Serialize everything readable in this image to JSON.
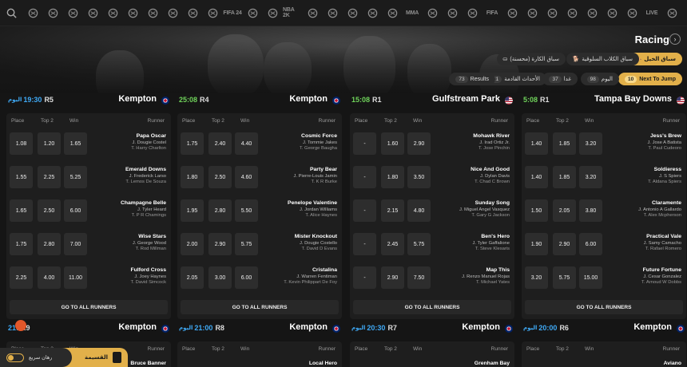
{
  "sports_bar": {
    "icons": [
      "search-icon",
      "american-football-icon",
      "boxing-icon",
      "cycling-icon",
      "golf-icon",
      "handball-icon",
      "flag-icon",
      "rugby-icon",
      "hockey-icon",
      "snooker-icon",
      "table-tennis-icon",
      "fifa-icon",
      "cricket-icon",
      "baseball-bat-icon",
      "nba-icon",
      "darts-icon",
      "tennis-icon",
      "volleyball-icon",
      "esports-icon",
      "billiards-icon",
      "mma-icon",
      "badminton-icon",
      "horse-icon",
      "shooting-icon",
      "fifa-icon-2",
      "motorsport-icon",
      "chat-icon",
      "basketball-icon",
      "tennis-racket-icon",
      "soccer-icon",
      "copy-icon",
      "tv-icon",
      "live-icon",
      "home-icon"
    ],
    "text_icons": {
      "fifa": "FIFA 24",
      "nba": "NBA 2K",
      "mma": "MMA",
      "fifa2": "FIFA",
      "live": "LIVE"
    }
  },
  "header": {
    "title": "Racing",
    "categories": [
      {
        "label": "سباق الخيل",
        "active": true
      },
      {
        "label": "سباق الكلاب السلوقية",
        "active": false
      },
      {
        "label": "سباق الكارة (محسنة)",
        "active": false
      }
    ],
    "filters": [
      {
        "count": "10",
        "label": "Next To Jump",
        "active": true
      },
      {
        "count": "98",
        "label": "اليوم",
        "active": false
      },
      {
        "count": "37",
        "label": "غدا",
        "active": false
      },
      {
        "count": "21",
        "label": "الأحداث القادمة",
        "active": false
      },
      {
        "count": "73",
        "label": "Results",
        "active": false
      }
    ]
  },
  "labels": {
    "place": "Place",
    "top2": "Top 2",
    "win": "Win",
    "runner": "Runner",
    "goto": "GO TO ALL RUNNERS",
    "today": "اليوم"
  },
  "races": [
    {
      "time": "19:30",
      "time_prefix": "اليوم",
      "race_no": "R5",
      "venue": "Kempton",
      "flag": "uk",
      "time_color": "#3fa9f5",
      "runners": [
        {
          "name": "Papa Oscar",
          "jockey": "J. Dougie Costel",
          "trainer": "T. Harry Charlton",
          "place": "1.08",
          "top2": "1.20",
          "win": "1.65"
        },
        {
          "name": "Emerald Downs",
          "jockey": "J. Frederick Larso",
          "trainer": "T. Lemos De Souza",
          "place": "1.55",
          "top2": "2.25",
          "win": "5.25"
        },
        {
          "name": "Champagne Belle",
          "jockey": "J. Tyler Heard",
          "trainer": "T. P R Chamings",
          "place": "1.65",
          "top2": "2.50",
          "win": "6.00"
        },
        {
          "name": "Wise Stars",
          "jockey": "J. George Wood",
          "trainer": "T. Rod Millman",
          "place": "1.75",
          "top2": "2.80",
          "win": "7.00"
        },
        {
          "name": "Fulford Cross",
          "jockey": "J. Joey Haynes",
          "trainer": "T. David Simcock",
          "place": "2.25",
          "top2": "4.00",
          "win": "11.00"
        }
      ]
    },
    {
      "time": "25:08",
      "time_prefix": "",
      "race_no": "R4",
      "venue": "Kempton",
      "flag": "uk",
      "time_color": "#6fd35a",
      "runners": [
        {
          "name": "Cosmic Force",
          "jockey": "J. Tommie Jakes",
          "trainer": "T. George Baugha",
          "place": "1.75",
          "top2": "2.40",
          "win": "4.40"
        },
        {
          "name": "Party Bear",
          "jockey": "J. Pierre-Louis Jamin",
          "trainer": "T. K R Burke",
          "place": "1.80",
          "top2": "2.50",
          "win": "4.60"
        },
        {
          "name": "Penelope Valentine",
          "jockey": "J. Jordan Williams",
          "trainer": "T. Alice Haynes",
          "place": "1.95",
          "top2": "2.80",
          "win": "5.50"
        },
        {
          "name": "Mister Knockout",
          "jockey": "J. Dougie Costello",
          "trainer": "T. David D Evans",
          "place": "2.00",
          "top2": "2.90",
          "win": "5.75"
        },
        {
          "name": "Cristalina",
          "jockey": "J. Warren Fentiman",
          "trainer": "T. Kevin Philippart De Foy",
          "place": "2.05",
          "top2": "3.00",
          "win": "6.00"
        }
      ]
    },
    {
      "time": "15:08",
      "time_prefix": "",
      "race_no": "R1",
      "venue": "Gulfstream Park",
      "flag": "us",
      "time_color": "#6fd35a",
      "runners": [
        {
          "name": "Mohawk River",
          "jockey": "J. Irad Ortiz Jr.",
          "trainer": "T. Jose Pinchin",
          "place": "-",
          "top2": "1.60",
          "win": "2.90"
        },
        {
          "name": "Nice And Good",
          "jockey": "J. Dylan Davis",
          "trainer": "T. Chad C Brown",
          "place": "-",
          "top2": "1.80",
          "win": "3.50"
        },
        {
          "name": "Sunday Song",
          "jockey": "J. Miguel Angel Vasquez",
          "trainer": "T. Gary G Jackson",
          "place": "-",
          "top2": "2.15",
          "win": "4.80"
        },
        {
          "name": "Ben's Hero",
          "jockey": "J. Tyler Gaffalione",
          "trainer": "T. Steve Klesaris",
          "place": "-",
          "top2": "2.45",
          "win": "5.75"
        },
        {
          "name": "Map This",
          "jockey": "J. Renzo Manuel Rojas",
          "trainer": "T. Michael Yates",
          "place": "-",
          "top2": "2.90",
          "win": "7.50"
        }
      ]
    },
    {
      "time": "5:08",
      "time_prefix": "",
      "race_no": "R1",
      "venue": "Tampa Bay Downs",
      "flag": "us",
      "time_color": "#6fd35a",
      "runners": [
        {
          "name": "Jess's Brew",
          "jockey": "J. Jose A Batista",
          "trainer": "T. Paul Cudeoro",
          "place": "1.40",
          "top2": "1.85",
          "win": "3.20"
        },
        {
          "name": "Soldieress",
          "jockey": "J. S Spiers",
          "trainer": "T. Aldana Spiers",
          "place": "1.40",
          "top2": "1.85",
          "win": "3.20"
        },
        {
          "name": "Claramente",
          "jockey": "J. Antonio A Gallardo",
          "trainer": "T. Alex Mcpherson",
          "place": "1.50",
          "top2": "2.05",
          "win": "3.80"
        },
        {
          "name": "Practical Vale",
          "jockey": "J. Samy Camacho",
          "trainer": "T. Rafael Romero",
          "place": "1.90",
          "top2": "2.90",
          "win": "6.00"
        },
        {
          "name": "Future Fortune",
          "jockey": "J. Cesar Gonzalez",
          "trainer": "T. Arnoud W Dobbs",
          "place": "3.20",
          "top2": "5.75",
          "win": "15.00"
        }
      ]
    }
  ],
  "next_races": [
    {
      "time": "21:",
      "time_prefix": "",
      "race_no": "R9",
      "venue": "Kempton",
      "flag": "uk",
      "time_color": "#3fa9f5",
      "first_runner": "Bruce Banner"
    },
    {
      "time": "21:00",
      "time_prefix": "اليوم",
      "race_no": "R8",
      "venue": "Kempton",
      "flag": "uk",
      "time_color": "#3fa9f5",
      "first_runner": "Local Hero"
    },
    {
      "time": "20:30",
      "time_prefix": "اليوم",
      "race_no": "R7",
      "venue": "Kempton",
      "flag": "uk",
      "time_color": "#3fa9f5",
      "first_runner": "Grenham Bay"
    },
    {
      "time": "20:00",
      "time_prefix": "اليوم",
      "race_no": "R6",
      "venue": "Kempton",
      "flag": "uk",
      "time_color": "#3fa9f5",
      "first_runner": "Aviano"
    }
  ],
  "widgets": {
    "betslip_label": "القسيمة",
    "quick_label": "رهان سريع"
  },
  "colors": {
    "accent": "#e2b04a",
    "bg": "#151515",
    "card": "#1e1e1e",
    "odd": "#2d2d2d"
  }
}
